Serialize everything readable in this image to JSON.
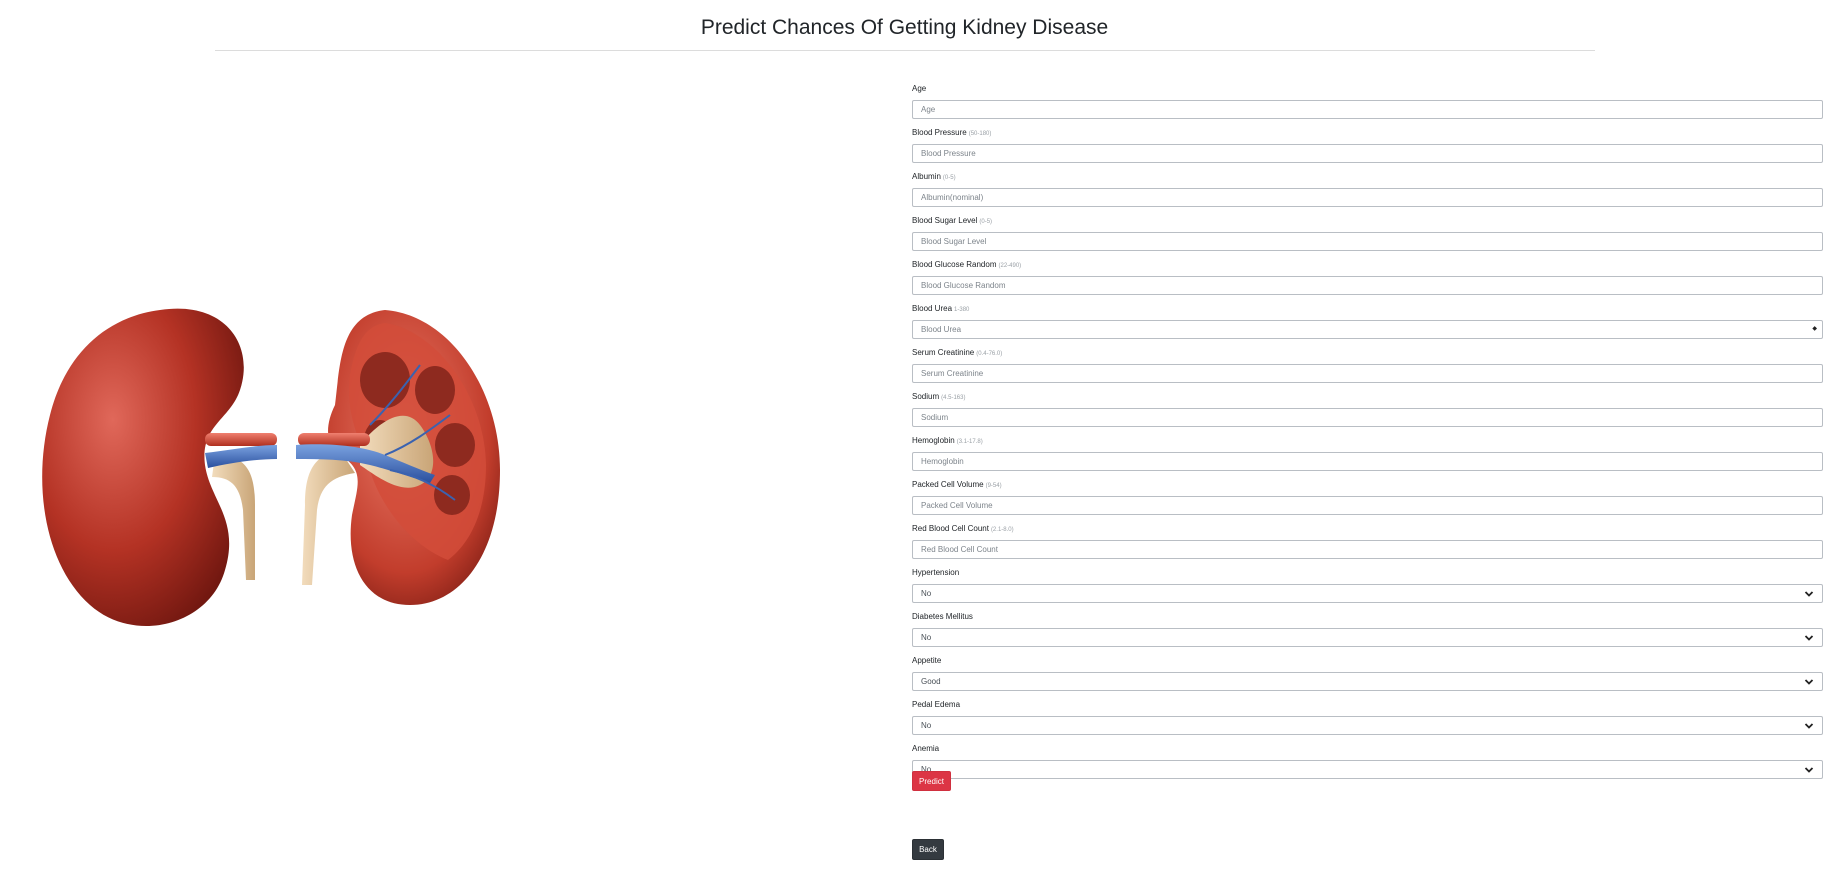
{
  "page": {
    "title": "Predict Chances Of Getting Kidney Disease"
  },
  "form": {
    "fields": [
      {
        "label": "Age",
        "hint": "",
        "placeholder": "Age"
      },
      {
        "label": "Blood Pressure",
        "hint": "(50-180)",
        "placeholder": "Blood Pressure"
      },
      {
        "label": "Albumin",
        "hint": "(0-5)",
        "placeholder": "Albumin(nominal)"
      },
      {
        "label": "Blood Sugar Level",
        "hint": "(0-5)",
        "placeholder": "Blood Sugar Level"
      },
      {
        "label": "Blood Glucose Random",
        "hint": "(22-490)",
        "placeholder": "Blood Glucose Random"
      },
      {
        "label": "Blood Urea",
        "hint": "1-380",
        "placeholder": "Blood Urea"
      },
      {
        "label": "Serum Creatinine",
        "hint": "(0.4-76.0)",
        "placeholder": "Serum Creatinine"
      },
      {
        "label": "Sodium",
        "hint": "(4.5-163)",
        "placeholder": "Sodium"
      },
      {
        "label": "Hemoglobin",
        "hint": "(3.1-17.8)",
        "placeholder": "Hemoglobin"
      },
      {
        "label": "Packed Cell Volume",
        "hint": "(9-54)",
        "placeholder": "Packed Cell Volume"
      },
      {
        "label": "Red Blood Cell Count",
        "hint": "(2.1-8.0)",
        "placeholder": "Red Blood Cell Count"
      }
    ],
    "selects": [
      {
        "label": "Hypertension",
        "value": "No"
      },
      {
        "label": "Diabetes Mellitus",
        "value": "No"
      },
      {
        "label": "Appetite",
        "value": "Good"
      },
      {
        "label": "Pedal Edema",
        "value": "No"
      },
      {
        "label": "Anemia",
        "value": "No"
      }
    ],
    "predict_label": "Predict",
    "back_label": "Back"
  },
  "colors": {
    "predict_button": "#dc3545",
    "back_button": "#343a40",
    "kidney_red": "#b0301f",
    "vein_blue": "#3a62b0",
    "ureter_tan": "#dcc09a"
  },
  "icons": {
    "select_arrow": "chevron-down-icon",
    "number_spinner": "spin-icon"
  }
}
